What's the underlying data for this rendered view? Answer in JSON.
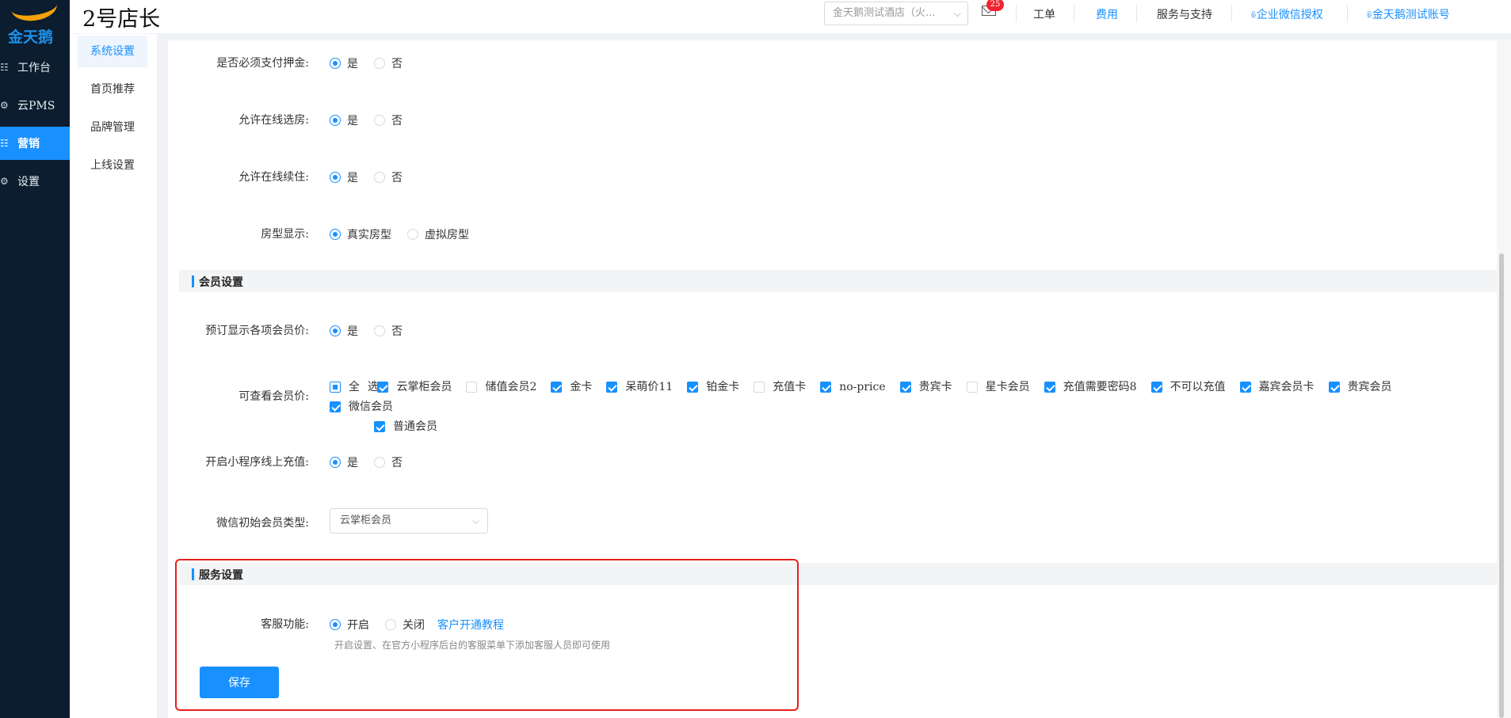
{
  "brand": {
    "logo_text": "金天鹅",
    "app_title": "2号店长"
  },
  "sidebar": {
    "items": [
      {
        "label": "工作台",
        "icon": "list-icon",
        "active": false
      },
      {
        "label": "云PMS",
        "icon": "gear-icon",
        "active": false
      },
      {
        "label": "营销",
        "icon": "list-icon",
        "active": true
      },
      {
        "label": "设置",
        "icon": "gear-icon",
        "active": false
      }
    ]
  },
  "submenu": {
    "items": [
      {
        "label": "系统设置",
        "active": true
      },
      {
        "label": "首页推荐",
        "active": false
      },
      {
        "label": "品牌管理",
        "active": false
      },
      {
        "label": "上线设置",
        "active": false
      }
    ]
  },
  "header": {
    "hotel_select": "金天鹅测试酒店（火...",
    "mail_count": "25",
    "links": {
      "work_order": "工单",
      "fees": "费用",
      "service": "服务与支持",
      "wechat_auth": "企业微信授权",
      "account": "金天鹅测试账号"
    }
  },
  "form": {
    "deposit": {
      "label": "是否必须支付押金:",
      "options": [
        "是",
        "否"
      ],
      "selected": "是"
    },
    "online_room_select": {
      "label": "允许在线选房:",
      "options": [
        "是",
        "否"
      ],
      "selected": "是"
    },
    "online_extend": {
      "label": "允许在线续住:",
      "options": [
        "是",
        "否"
      ],
      "selected": "是"
    },
    "room_type_display": {
      "label": "房型显示:",
      "options": [
        "真实房型",
        "虚拟房型"
      ],
      "selected": "真实房型"
    },
    "member_section_title": "会员设置",
    "show_member_prices": {
      "label": "预订显示各项会员价:",
      "options": [
        "是",
        "否"
      ],
      "selected": "是"
    },
    "viewable_member_prices": {
      "label": "可查看会员价:",
      "select_all_label": "全选",
      "items": [
        {
          "label": "云掌柜会员",
          "checked": true
        },
        {
          "label": "储值会员2",
          "checked": false
        },
        {
          "label": "金卡",
          "checked": true
        },
        {
          "label": "呆萌价11",
          "checked": true
        },
        {
          "label": "铂金卡",
          "checked": true
        },
        {
          "label": "充值卡",
          "checked": false
        },
        {
          "label": "no-price",
          "checked": true
        },
        {
          "label": "贵宾卡",
          "checked": true
        },
        {
          "label": "星卡会员",
          "checked": false
        },
        {
          "label": "充值需要密码8",
          "checked": true
        },
        {
          "label": "不可以充值",
          "checked": true
        },
        {
          "label": "嘉宾会员卡",
          "checked": true
        },
        {
          "label": "贵宾会员",
          "checked": true
        },
        {
          "label": "微信会员",
          "checked": true
        },
        {
          "label": "普通会员",
          "checked": true
        }
      ]
    },
    "mini_program_recharge": {
      "label": "开启小程序线上充值:",
      "options": [
        "是",
        "否"
      ],
      "selected": "是"
    },
    "wechat_initial_member": {
      "label": "微信初始会员类型:",
      "value": "云掌柜会员"
    },
    "service_section_title": "服务设置",
    "customer_service": {
      "label": "客服功能:",
      "options": [
        "开启",
        "关闭"
      ],
      "selected": "开启",
      "tutorial_link": "客户开通教程",
      "hint": "开启设置、在官方小程序后台的客服菜单下添加客服人员即可使用"
    },
    "save_label": "保存"
  },
  "colors": {
    "accent": "#1890ff",
    "sidebar_bg": "#0b1d2e",
    "highlight": "#e8201c",
    "logo_orange": "#f4a10b"
  }
}
